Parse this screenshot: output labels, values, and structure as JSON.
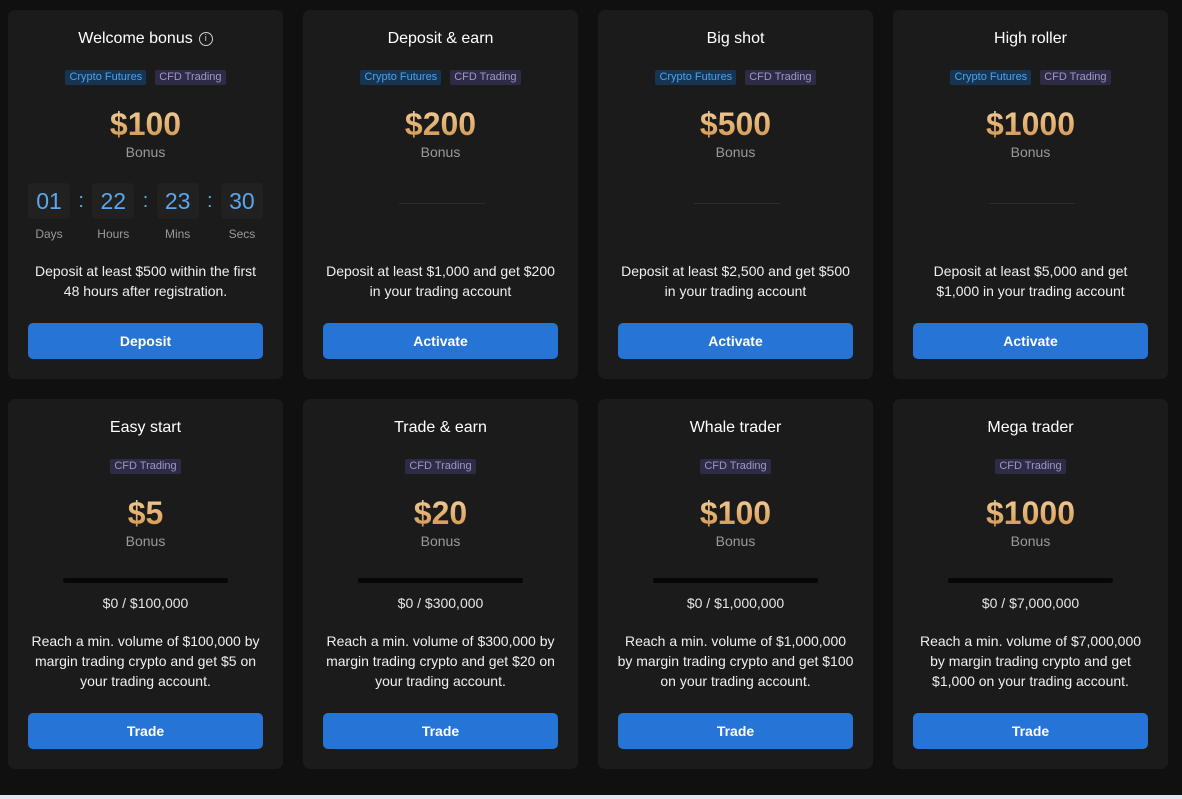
{
  "bonus_label": "Bonus",
  "info_icon": "info-icon",
  "tags": {
    "crypto": "Crypto Futures",
    "cfd": "CFD Trading"
  },
  "countdown": {
    "days": "01",
    "hours": "22",
    "mins": "23",
    "secs": "30",
    "days_label": "Days",
    "hours_label": "Hours",
    "mins_label": "Mins",
    "secs_label": "Secs",
    "separator": ":"
  },
  "deposit_cards": [
    {
      "title": "Welcome bonus",
      "amount": "$100",
      "description": "Deposit at least $500 within the first 48 hours after registration.",
      "button": "Deposit"
    },
    {
      "title": "Deposit & earn",
      "amount": "$200",
      "description": "Deposit at least $1,000 and get $200 in your trading account",
      "button": "Activate"
    },
    {
      "title": "Big shot",
      "amount": "$500",
      "description": "Deposit at least $2,500 and get $500 in your trading account",
      "button": "Activate"
    },
    {
      "title": "High roller",
      "amount": "$1000",
      "description": "Deposit at least $5,000 and get $1,000 in your trading account",
      "button": "Activate"
    }
  ],
  "volume_cards": [
    {
      "title": "Easy start",
      "amount": "$5",
      "progress_text": "$0 / $100,000",
      "progress": 0,
      "description": "Reach a min. volume of $100,000 by margin trading crypto and get $5 on your trading account.",
      "button": "Trade"
    },
    {
      "title": "Trade & earn",
      "amount": "$20",
      "progress_text": "$0 / $300,000",
      "progress": 0,
      "description": "Reach a min. volume of $300,000 by margin trading crypto and get $20 on your trading account.",
      "button": "Trade"
    },
    {
      "title": "Whale trader",
      "amount": "$100",
      "progress_text": "$0 / $1,000,000",
      "progress": 0,
      "description": "Reach a min. volume of $1,000,000 by margin trading crypto and get $100 on your trading account.",
      "button": "Trade"
    },
    {
      "title": "Mega trader",
      "amount": "$1000",
      "progress_text": "$0 / $7,000,000",
      "progress": 0,
      "description": "Reach a min. volume of $7,000,000 by margin trading crypto and get $1,000 on your trading account.",
      "button": "Trade"
    }
  ],
  "colors": {
    "background": "#101010",
    "card": "#1b1b1b",
    "accent": "#2675d6",
    "gold": "#e5b57a",
    "countdown_digits": "#5aa7ee",
    "crypto_tag_bg": "#163552",
    "crypto_tag_text": "#4ea1ea",
    "cfd_tag_bg": "#2d2b45",
    "cfd_tag_text": "#9c99c2"
  }
}
